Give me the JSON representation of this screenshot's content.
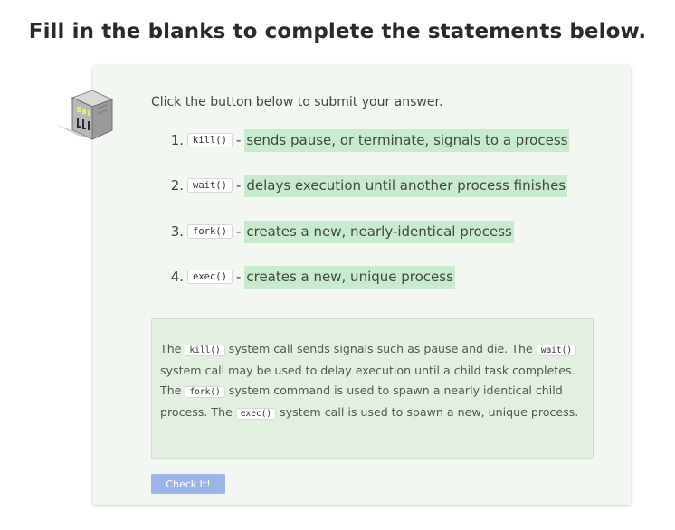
{
  "title": "Fill in the blanks to complete the statements below.",
  "instruction": "Click the button below to submit your answer.",
  "items": [
    {
      "number": "1.",
      "code": "kill()",
      "separator": "-",
      "answer": "sends pause, or terminate, signals to a process"
    },
    {
      "number": "2.",
      "code": "wait()",
      "separator": "-",
      "answer": "delays execution until another process finishes"
    },
    {
      "number": "3.",
      "code": "fork()",
      "separator": "-",
      "answer": "creates a new, nearly-identical process"
    },
    {
      "number": "4.",
      "code": "exec()",
      "separator": "-",
      "answer": "creates a new, unique process"
    }
  ],
  "explanation": {
    "p1": "The ",
    "c1": "kill()",
    "p2": " system call sends signals such as pause and die. The ",
    "c2": "wait()",
    "p3": " system call may be used to delay execution until a child task completes. The ",
    "c3": "fork()",
    "p4": " system command is used to spawn a nearly identical child process. The ",
    "c4": "exec()",
    "p5": " system call is used to spawn a new, unique process."
  },
  "button": {
    "label": "Check It!"
  },
  "colors": {
    "answer_highlight": "#c7ebcc",
    "card_bg": "#f2f7f2",
    "explanation_bg": "#e3efe1",
    "button_bg": "#9bb6e6"
  },
  "icons": {
    "mascot": "building-mascot-icon"
  }
}
